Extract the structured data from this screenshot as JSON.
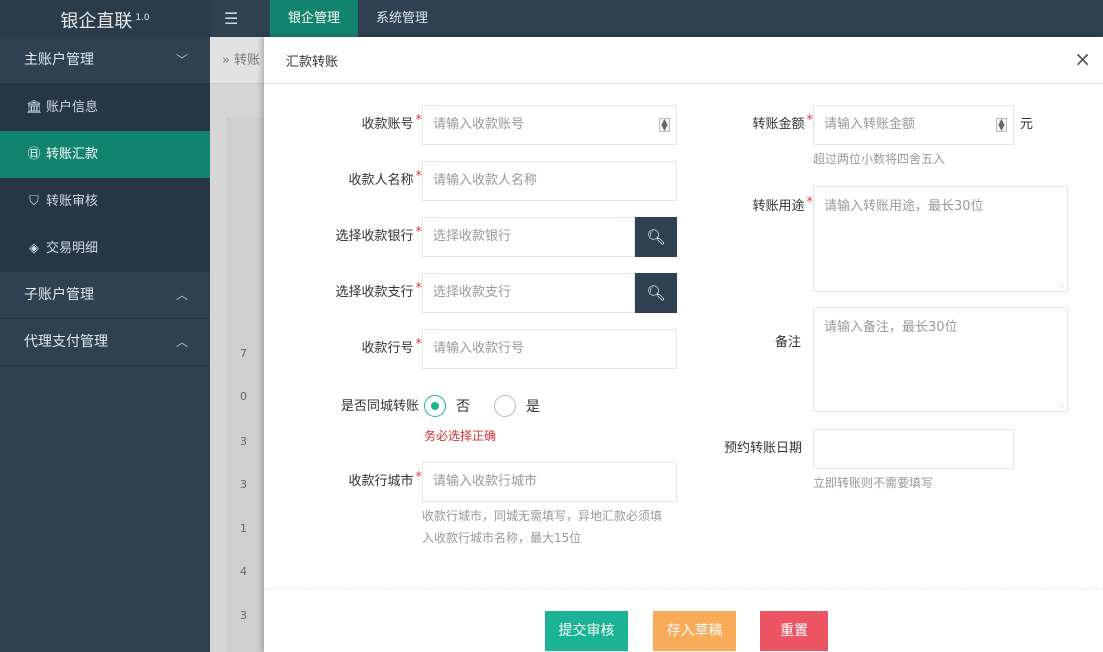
{
  "brand": {
    "name": "银企直联",
    "version": "1.0"
  },
  "topnav": {
    "toggle_icon": "menu-icon",
    "tabs": [
      "银企管理",
      "系统管理"
    ]
  },
  "sidebar": {
    "group_main": "主账户管理",
    "items": [
      "账户信息",
      "转账汇款",
      "转账审核",
      "交易明细"
    ],
    "group_sub": "子账户管理",
    "group_agent": "代理支付管理"
  },
  "breadcrumb": "» 转账",
  "background_rows": [
    "7",
    "0",
    "3",
    "3",
    "1",
    "4",
    "3"
  ],
  "modal": {
    "title": "汇款转账",
    "close": "×",
    "fields": {
      "account_label": "收款账号",
      "account_placeholder": "请输入收款账号",
      "name_label": "收款人名称",
      "name_placeholder": "请输入收款人名称",
      "bank_label": "选择收款银行",
      "bank_placeholder": "选择收款银行",
      "branch_label": "选择收款支行",
      "branch_placeholder": "选择收款支行",
      "bankno_label": "收款行号",
      "bankno_placeholder": "请输入收款行号",
      "samecity_label": "是否同城转账",
      "option_no": "否",
      "option_yes": "是",
      "selected": "否",
      "samecity_error": "务必选择正确",
      "city_label": "收款行城市",
      "city_placeholder": "请输入收款行城市",
      "city_hint_1": "收款行城市，同城无需填写，异地汇款必须填",
      "city_hint_2": "入收款行城市名称，最大15位",
      "amount_label": "转账金额",
      "amount_placeholder": "请输入转账金额",
      "amount_unit": "元",
      "amount_hint": "超过两位小数将四舍五入",
      "purpose_label": "转账用途",
      "purpose_placeholder": "请输入转账用途，最长30位",
      "remark_label": "备注",
      "remark_placeholder": "请输入备注，最长30位",
      "date_label": "预约转账日期",
      "date_hint": "立即转账则不需要填写"
    },
    "buttons": {
      "submit": "提交审核",
      "draft": "存入草稿",
      "reset": "重置"
    }
  },
  "colors": {
    "accent": "#1ab394",
    "active_nav": "#12846e",
    "sidebar": "#2f4050",
    "draft": "#f8ac59",
    "reset": "#ed5565",
    "required": "#e4393c"
  }
}
